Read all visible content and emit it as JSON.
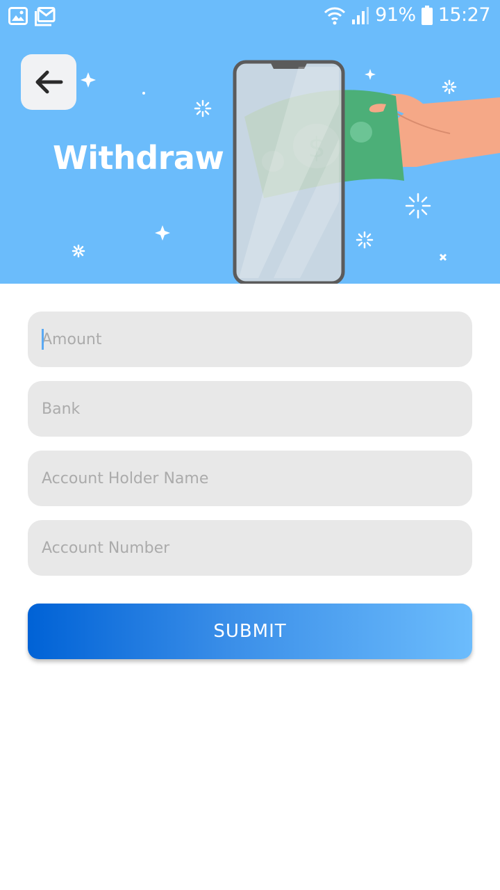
{
  "status_bar": {
    "battery": "91%",
    "time": "15:27",
    "icons": [
      "gallery-icon",
      "mail-icon",
      "wifi-icon",
      "signal-icon",
      "battery-icon"
    ]
  },
  "header": {
    "title": "Withdraw",
    "back_icon": "arrow-left-icon",
    "background_color": "#6bbcfb"
  },
  "form": {
    "amount_placeholder": "Amount",
    "bank_placeholder": "Bank",
    "holder_placeholder": "Account Holder Name",
    "account_number_placeholder": "Account Number",
    "submit_label": "SUBMIT"
  },
  "colors": {
    "field_bg": "#e8e8e8",
    "button_start": "#0062d6",
    "button_end": "#6cbcfc"
  }
}
